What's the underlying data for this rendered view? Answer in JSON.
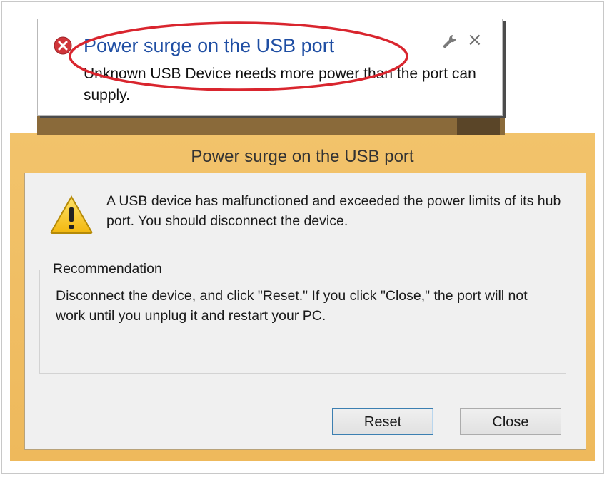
{
  "toast": {
    "title": "Power surge on the USB port",
    "message": "Unknown USB Device needs more power than the port can supply.",
    "icons": [
      "error-icon",
      "wrench-icon",
      "close-icon"
    ],
    "close_glyph": "×"
  },
  "dialog": {
    "title": "Power surge on the USB port",
    "message": "A USB device has malfunctioned and exceeded the power limits of its hub port. You should disconnect the device.",
    "recommendation": {
      "label": "Recommendation",
      "text": "Disconnect the device, and click \"Reset.\" If you click \"Close,\" the port will not work until you unplug it and restart your PC."
    },
    "buttons": {
      "reset": "Reset",
      "close": "Close"
    }
  },
  "colors": {
    "toast_title": "#1f4ea3",
    "dialog_frame": "#f0c26e",
    "annotation_ellipse": "#d9252e",
    "error_red": "#d0353a",
    "warning_yellow": "#f5c518"
  }
}
